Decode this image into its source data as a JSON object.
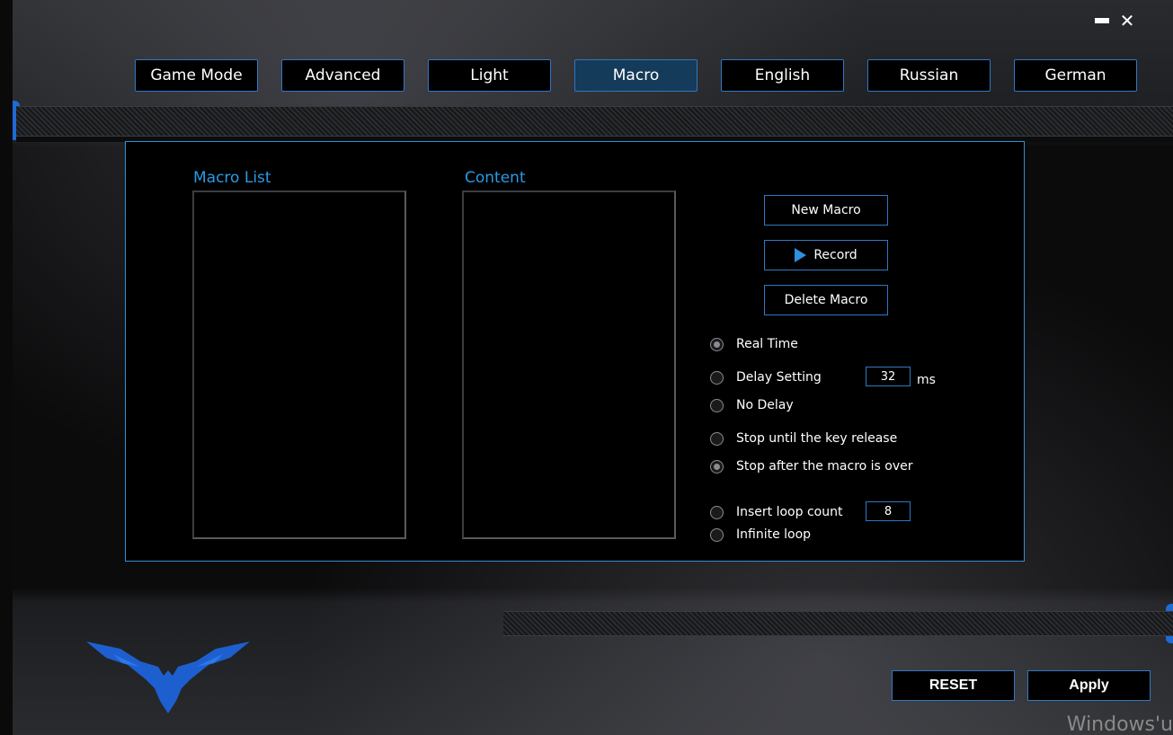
{
  "window": {
    "minimize_icon": "minimize-icon",
    "close_icon": "close-icon"
  },
  "tabs": [
    {
      "label": "Game Mode",
      "active": false
    },
    {
      "label": "Advanced",
      "active": false
    },
    {
      "label": "Light",
      "active": false
    },
    {
      "label": "Macro",
      "active": true
    },
    {
      "label": "English",
      "active": false
    },
    {
      "label": "Russian",
      "active": false
    },
    {
      "label": "German",
      "active": false
    }
  ],
  "macro_panel": {
    "macro_list_title": "Macro List",
    "content_title": "Content",
    "buttons": {
      "new_macro": "New Macro",
      "record": "Record",
      "delete_macro": "Delete Macro"
    },
    "delay_options": [
      {
        "label": "Real Time",
        "checked": true
      },
      {
        "label": "Delay Setting",
        "checked": false
      },
      {
        "label": "No Delay",
        "checked": false
      }
    ],
    "delay_value": "32",
    "delay_unit": "ms",
    "stop_options": [
      {
        "label": "Stop until the key release",
        "checked": false
      },
      {
        "label": "Stop after the macro is over",
        "checked": true
      }
    ],
    "loop_options": [
      {
        "label": "Insert loop count",
        "checked": false
      },
      {
        "label": "Infinite loop",
        "checked": false
      }
    ],
    "loop_count": "8"
  },
  "footer": {
    "reset_label": "RESET",
    "apply_label": "Apply",
    "watermark": "Windows'u"
  },
  "colors": {
    "accent": "#2f78c4",
    "title_blue": "#2a9ae4",
    "active_tab": "#143b59",
    "logo_blue": "#1e5fd0"
  },
  "icons": {
    "logo": "eagle-logo-icon",
    "record": "play-icon"
  }
}
